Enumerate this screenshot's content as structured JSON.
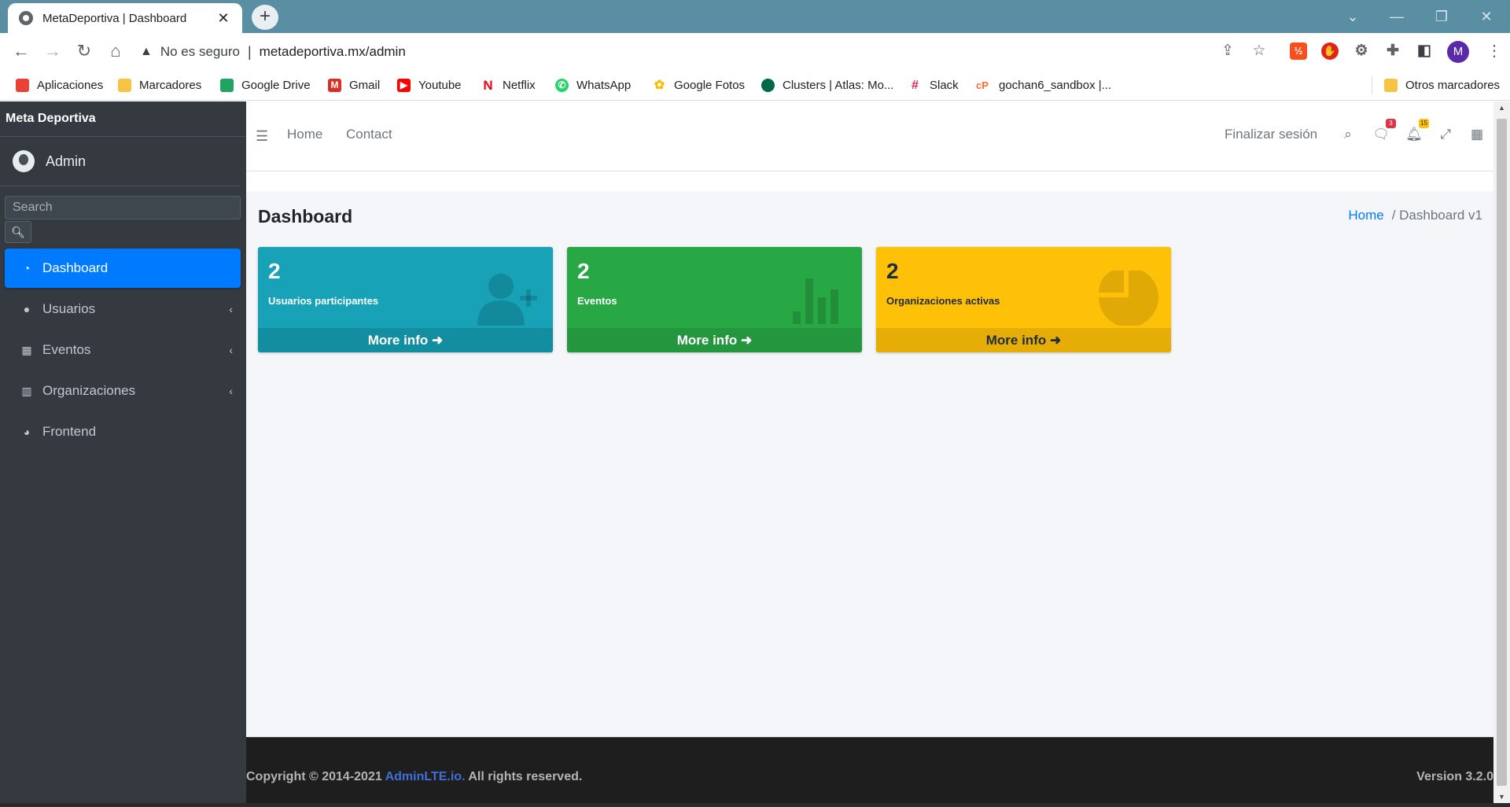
{
  "browser": {
    "tab_title": "MetaDeportiva | Dashboard",
    "close_glyph": "✕",
    "new_tab_glyph": "+",
    "security_warning": "No es seguro",
    "url": "metadeportiva.mx/admin",
    "profile_initial": "M",
    "bookmarks": [
      {
        "label": "Aplicaciones",
        "color": "#ea4335"
      },
      {
        "label": "Marcadores",
        "color": "#f6c344"
      },
      {
        "label": "Google Drive",
        "color": "#1fa463"
      },
      {
        "label": "Gmail",
        "color": "#d93025"
      },
      {
        "label": "Youtube",
        "color": "#ff0000"
      },
      {
        "label": "Netflix",
        "color": "#e50914"
      },
      {
        "label": "WhatsApp",
        "color": "#25d366"
      },
      {
        "label": "Google Fotos",
        "color": "#fbbc04"
      },
      {
        "label": "Clusters | Atlas: Mo...",
        "color": "#00684a"
      },
      {
        "label": "Slack",
        "color": "#4a154b"
      },
      {
        "label": "gochan6_sandbox |...",
        "color": "#ff6c2c"
      }
    ],
    "other_bookmarks": "Otros marcadores"
  },
  "sidebar": {
    "brand": "Meta Deportiva",
    "user_name": "Admin",
    "search_placeholder": "Search",
    "items": [
      {
        "label": "Dashboard",
        "icon": "tachometer-icon",
        "active": true
      },
      {
        "label": "Usuarios",
        "icon": "user-icon",
        "has_submenu": true
      },
      {
        "label": "Eventos",
        "icon": "calendar-icon",
        "has_submenu": true
      },
      {
        "label": "Organizaciones",
        "icon": "building-icon",
        "has_submenu": true
      },
      {
        "label": "Frontend",
        "icon": "palette-icon"
      }
    ]
  },
  "header": {
    "nav_links": [
      "Home",
      "Contact"
    ],
    "logout": "Finalizar sesión",
    "messages_badge": "3",
    "notifications_badge": "15"
  },
  "content": {
    "title": "Dashboard",
    "breadcrumb_home": "Home",
    "breadcrumb_current": "/ Dashboard v1",
    "boxes": [
      {
        "count": "2",
        "label": "Usuarios participantes",
        "footer": "More info",
        "color": "#17a2b8",
        "icon": "user-plus-icon"
      },
      {
        "count": "2",
        "label": "Eventos",
        "footer": "More info",
        "color": "#28a745",
        "icon": "bar-chart-icon"
      },
      {
        "count": "2",
        "label": "Organizaciones activas",
        "footer": "More info",
        "color": "#ffc107",
        "icon": "pie-chart-icon"
      }
    ]
  },
  "footer": {
    "copyright_prefix": "Copyright © 2014-2021 ",
    "copyright_link": "AdminLTE.io.",
    "copyright_suffix": " All rights reserved.",
    "version": "Version 3.2.0"
  }
}
